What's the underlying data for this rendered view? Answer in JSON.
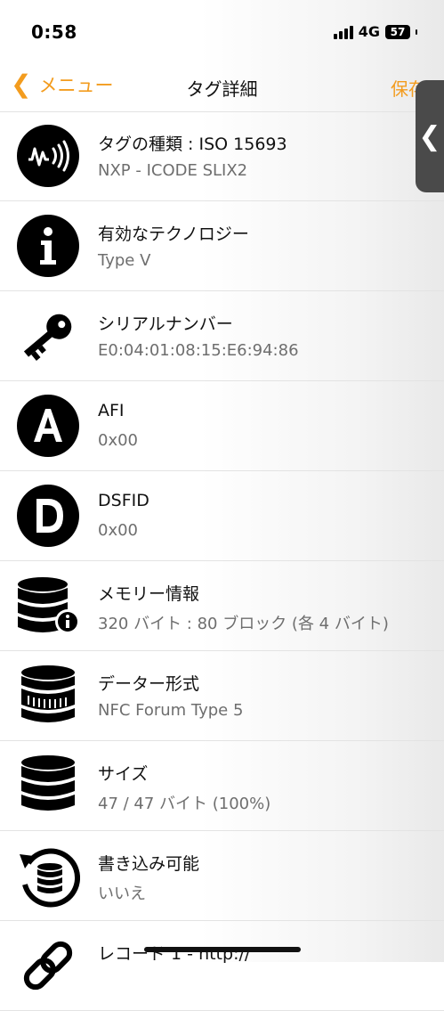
{
  "status_bar": {
    "time": "0:58",
    "network": "4G",
    "battery": "57"
  },
  "nav": {
    "back_label": "メニュー",
    "title": "タグ詳細",
    "save_label": "保存"
  },
  "rows": [
    {
      "title": "タグの種類 : ISO 15693",
      "subtitle": "NXP - ICODE SLIX2",
      "icon": "nfc-tag-icon"
    },
    {
      "title": "有効なテクノロジー",
      "subtitle": "Type V",
      "icon": "info-icon"
    },
    {
      "title": "シリアルナンバー",
      "subtitle": "E0:04:01:08:15:E6:94:86",
      "icon": "key-icon"
    },
    {
      "title": "AFI",
      "subtitle": "0x00",
      "icon": "letter-a-icon"
    },
    {
      "title": "DSFID",
      "subtitle": "0x00",
      "icon": "letter-d-icon"
    },
    {
      "title": "メモリー情報",
      "subtitle": "320 バイト : 80 ブロック (各 4 バイト)",
      "icon": "database-info-icon"
    },
    {
      "title": "データー形式",
      "subtitle": "NFC Forum Type 5",
      "icon": "database-format-icon"
    },
    {
      "title": "サイズ",
      "subtitle": "47 / 47 バイト (100%)",
      "icon": "database-icon"
    },
    {
      "title": "書き込み可能",
      "subtitle": "いいえ",
      "icon": "database-refresh-icon"
    },
    {
      "title": "レコード 1 - http://",
      "subtitle": "",
      "icon": "link-icon"
    }
  ],
  "colors": {
    "accent": "#f39c1e",
    "text": "#111111",
    "subtext": "#6e6e6e",
    "separator": "#e3e3e3"
  }
}
